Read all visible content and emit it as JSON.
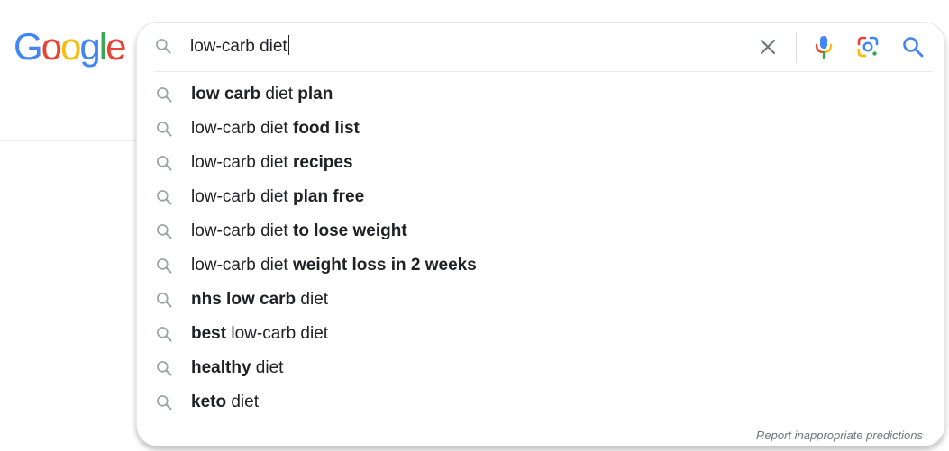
{
  "logo": {
    "letters": [
      {
        "char": "G",
        "color": "#4285F4"
      },
      {
        "char": "o",
        "color": "#EA4335"
      },
      {
        "char": "o",
        "color": "#FBBC05"
      },
      {
        "char": "g",
        "color": "#4285F4"
      },
      {
        "char": "l",
        "color": "#34A853"
      },
      {
        "char": "e",
        "color": "#EA4335"
      }
    ]
  },
  "search": {
    "query": "low-carb diet"
  },
  "icons": {
    "search_left": "search-icon",
    "clear": "close-icon",
    "voice": "microphone-icon",
    "lens": "google-lens-icon",
    "submit": "search-icon"
  },
  "suggestions": [
    {
      "parts": [
        {
          "t": "low carb",
          "b": true
        },
        {
          "t": " diet ",
          "b": false
        },
        {
          "t": "plan",
          "b": true
        }
      ]
    },
    {
      "parts": [
        {
          "t": "low-carb diet ",
          "b": false
        },
        {
          "t": "food list",
          "b": true
        }
      ]
    },
    {
      "parts": [
        {
          "t": "low-carb diet ",
          "b": false
        },
        {
          "t": "recipes",
          "b": true
        }
      ]
    },
    {
      "parts": [
        {
          "t": "low-carb diet ",
          "b": false
        },
        {
          "t": "plan free",
          "b": true
        }
      ]
    },
    {
      "parts": [
        {
          "t": "low-carb diet ",
          "b": false
        },
        {
          "t": "to lose weight",
          "b": true
        }
      ]
    },
    {
      "parts": [
        {
          "t": "low-carb diet ",
          "b": false
        },
        {
          "t": "weight loss in 2 weeks",
          "b": true
        }
      ]
    },
    {
      "parts": [
        {
          "t": "nhs low carb",
          "b": true
        },
        {
          "t": " diet",
          "b": false
        }
      ]
    },
    {
      "parts": [
        {
          "t": "best",
          "b": true
        },
        {
          "t": " low-carb diet",
          "b": false
        }
      ]
    },
    {
      "parts": [
        {
          "t": "healthy",
          "b": true
        },
        {
          "t": " diet",
          "b": false
        }
      ]
    },
    {
      "parts": [
        {
          "t": "keto",
          "b": true
        },
        {
          "t": " diet",
          "b": false
        }
      ]
    }
  ],
  "report_link": "Report inappropriate predictions"
}
